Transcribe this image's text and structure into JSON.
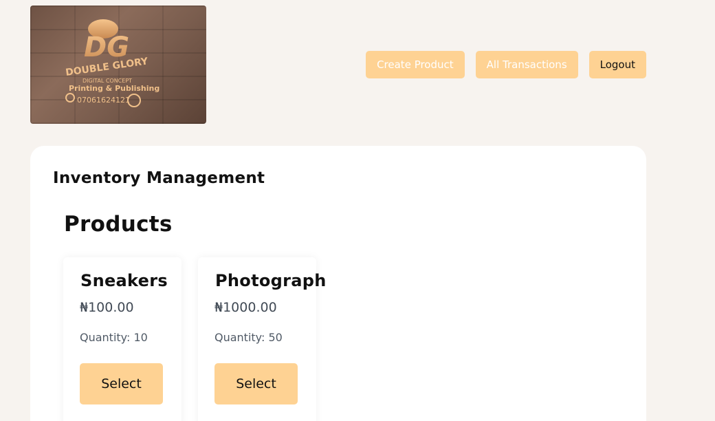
{
  "logo": {
    "initials": "DG",
    "brand": "DOUBLE GLORY",
    "line1": "DIGITAL CONCEPT",
    "line2": "Printing & Publishing",
    "phone": "07061624121"
  },
  "nav": {
    "create_product": "Create Product",
    "all_transactions": "All Transactions",
    "logout": "Logout"
  },
  "main": {
    "title": "Inventory Management",
    "section_title": "Products",
    "products": [
      {
        "name": "Sneakers",
        "price": "₦100.00",
        "quantity": "Quantity: 10",
        "button": "Select"
      },
      {
        "name": "Photograph",
        "price": "₦1000.00",
        "quantity": "Quantity: 50",
        "button": "Select"
      }
    ]
  },
  "colors": {
    "accent": "#fed293",
    "background": "#f7f3ef",
    "card": "#ffffff"
  }
}
